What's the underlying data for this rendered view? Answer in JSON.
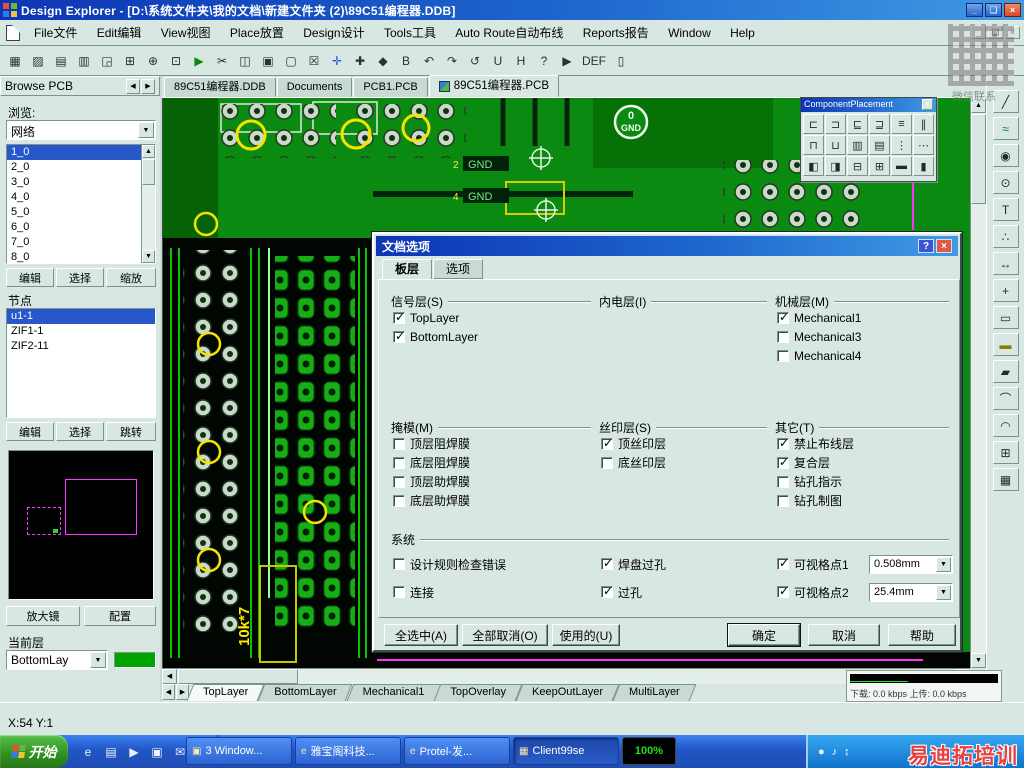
{
  "window": {
    "title": "Design Explorer - [D:\\系统文件夹\\我的文档\\新建文件夹 (2)\\89C51编程器.DDB]",
    "minimize_glyph": "_",
    "restore_glyph": "❏",
    "close_glyph": "×"
  },
  "ui": {
    "combo_arrow": "▼",
    "scroll_up": "▲",
    "scroll_down": "▼",
    "scroll_left": "◀",
    "scroll_right": "▶"
  },
  "menu": {
    "items": [
      {
        "label": "File文件"
      },
      {
        "label": "Edit编辑"
      },
      {
        "label": "View视图"
      },
      {
        "label": "Place放置"
      },
      {
        "label": "Design设计"
      },
      {
        "label": "Tools工具"
      },
      {
        "label": "Auto Route自动布线"
      },
      {
        "label": "Reports报告"
      },
      {
        "label": "Window"
      },
      {
        "label": "Help"
      }
    ]
  },
  "toolbar": {
    "buttons": [
      {
        "name": "explorer-toggle-icon",
        "glyph": "▦"
      },
      {
        "name": "open-document-icon",
        "glyph": "▨"
      },
      {
        "name": "save-icon",
        "glyph": "▤"
      },
      {
        "name": "print-icon",
        "glyph": "▥"
      },
      {
        "name": "print-preview-icon",
        "glyph": "◲"
      },
      {
        "name": "zoom-window-icon",
        "glyph": "⊞"
      },
      {
        "name": "zoom-point-icon",
        "glyph": "⊕"
      },
      {
        "name": "fit-document-icon",
        "glyph": "⊡"
      },
      {
        "name": "run-macro-icon",
        "glyph": "▶",
        "green": true
      },
      {
        "name": "cut-icon",
        "glyph": "✂"
      },
      {
        "name": "copy-icon",
        "glyph": "◫"
      },
      {
        "name": "paste-icon",
        "glyph": "▣"
      },
      {
        "name": "select-area-icon",
        "glyph": "▢"
      },
      {
        "name": "deselect-icon",
        "glyph": "☒"
      },
      {
        "name": "move-object-icon",
        "glyph": "✛",
        "blue": true
      },
      {
        "name": "crosshair-icon",
        "glyph": "✚"
      },
      {
        "name": "highlight-icon",
        "glyph": "◆"
      },
      {
        "name": "bold-text-icon",
        "glyph": "B"
      },
      {
        "name": "undo-icon",
        "glyph": "↶"
      },
      {
        "name": "redo-icon",
        "glyph": "↷"
      },
      {
        "name": "refresh-icon",
        "glyph": "↺"
      },
      {
        "name": "underline-tool-icon",
        "glyph": "U"
      },
      {
        "name": "h-tool-icon",
        "glyph": "H"
      },
      {
        "name": "help-icon",
        "glyph": "?"
      },
      {
        "name": "arrow-icon",
        "glyph": "▶"
      },
      {
        "name": "def-icon",
        "glyph": "DEF"
      },
      {
        "name": "clipboard-icon",
        "glyph": "▯"
      }
    ]
  },
  "doc_tabs": {
    "items": [
      {
        "label": "89C51编程器.DDB"
      },
      {
        "label": "Documents"
      },
      {
        "label": "PCB1.PCB"
      },
      {
        "label": "89C51编程器.PCB",
        "active": true
      }
    ]
  },
  "sidebar": {
    "tab_label": "Browse PCB",
    "browse_label": "浏览:",
    "browse_mode": "网络",
    "nets": [
      {
        "label": "1_0",
        "selected": true
      },
      {
        "label": "2_0"
      },
      {
        "label": "3_0"
      },
      {
        "label": "4_0"
      },
      {
        "label": "5_0"
      },
      {
        "label": "6_0"
      },
      {
        "label": "7_0"
      },
      {
        "label": "8_0"
      }
    ],
    "net_buttons": [
      {
        "label": "编辑"
      },
      {
        "label": "选择"
      },
      {
        "label": "缩放"
      }
    ],
    "nodes_label": "节点",
    "nodes": [
      {
        "label": "u1-1",
        "selected": true
      },
      {
        "label": "ZIF1-1"
      },
      {
        "label": "ZIF2-11"
      }
    ],
    "node_buttons": [
      {
        "label": "编辑"
      },
      {
        "label": "选择"
      },
      {
        "label": "跳转"
      }
    ],
    "magnifier_button": "放大镜",
    "config_button": "配置",
    "current_layer_label": "当前层",
    "current_layer": "BottomLay"
  },
  "editor": {
    "gnd_badge": {
      "line1": "0",
      "line2": "GND"
    },
    "net_label_1": "GND",
    "net_label_2": "GND",
    "ref_1": "2",
    "ref_2": "4",
    "resistor_label": "10k*7"
  },
  "component_placement": {
    "title": "ComponentPlacement",
    "close_glyph": "×",
    "tools": [
      {
        "name": "align-left-icon",
        "glyph": "⊏"
      },
      {
        "name": "align-right-icon",
        "glyph": "⊐"
      },
      {
        "name": "shift-left-icon",
        "glyph": "⊑"
      },
      {
        "name": "shift-right-icon",
        "glyph": "⊒"
      },
      {
        "name": "center-horizontal-icon",
        "glyph": "≡"
      },
      {
        "name": "space-horizontal-icon",
        "glyph": "∥"
      },
      {
        "name": "align-top-icon",
        "glyph": "⊓"
      },
      {
        "name": "align-bottom-icon",
        "glyph": "⊔"
      },
      {
        "name": "center-vertical-icon",
        "glyph": "▥"
      },
      {
        "name": "space-vertical-icon",
        "glyph": "▤"
      },
      {
        "name": "distribute-columns-icon",
        "glyph": "⋮"
      },
      {
        "name": "distribute-rows-icon",
        "glyph": "⋯"
      },
      {
        "name": "arrange-left-icon",
        "glyph": "◧"
      },
      {
        "name": "arrange-right-icon",
        "glyph": "◨"
      },
      {
        "name": "shrink-spacing-icon",
        "glyph": "⊟"
      },
      {
        "name": "expand-spacing-icon",
        "glyph": "⊞"
      },
      {
        "name": "room-icon",
        "glyph": "▬"
      },
      {
        "name": "component-icon",
        "glyph": "▮"
      }
    ]
  },
  "right_tools": [
    {
      "name": "place-track-icon",
      "glyph": "╱"
    },
    {
      "name": "place-multitrack-icon",
      "glyph": "≈"
    },
    {
      "name": "place-pad-icon",
      "glyph": "◉"
    },
    {
      "name": "place-via-icon",
      "glyph": "⊙"
    },
    {
      "name": "place-string-icon",
      "glyph": "T"
    },
    {
      "name": "place-coordinate-icon",
      "glyph": "∴"
    },
    {
      "name": "place-dimension-icon",
      "glyph": "↔"
    },
    {
      "name": "place-origin-icon",
      "glyph": "+"
    },
    {
      "name": "place-room-icon",
      "glyph": "▭"
    },
    {
      "name": "place-fill-icon",
      "glyph": "▬"
    },
    {
      "name": "place-polygon-icon",
      "glyph": "▰"
    },
    {
      "name": "place-arc-center-icon",
      "glyph": "⌒"
    },
    {
      "name": "place-arc-edge-icon",
      "glyph": "◠"
    },
    {
      "name": "place-array-icon",
      "glyph": "⊞"
    },
    {
      "name": "split-plane-icon",
      "glyph": "▦"
    }
  ],
  "dialog": {
    "title": "文档选项",
    "help_glyph": "?",
    "close_glyph": "×",
    "tabs": [
      {
        "label": "板层",
        "active": true
      },
      {
        "label": "选项",
        "active": false
      }
    ],
    "signal": {
      "label": "信号层(S)",
      "items": [
        {
          "label": "TopLayer",
          "checked": true
        },
        {
          "label": "BottomLayer",
          "checked": true
        }
      ]
    },
    "internal": {
      "label": "内电层(I)",
      "items": []
    },
    "mechanical": {
      "label": "机械层(M)",
      "items": [
        {
          "label": "Mechanical1",
          "checked": true
        },
        {
          "label": "Mechanical3"
        },
        {
          "label": "Mechanical4"
        }
      ]
    },
    "mask": {
      "label": "掩模(M)",
      "items": [
        {
          "label": "顶层阻焊膜"
        },
        {
          "label": "底层阻焊膜"
        },
        {
          "label": "顶层助焊膜"
        },
        {
          "label": "底层助焊膜"
        }
      ]
    },
    "silk": {
      "label": "丝印层(S)",
      "items": [
        {
          "label": "顶丝印层",
          "checked": true
        },
        {
          "label": "底丝印层"
        }
      ]
    },
    "other": {
      "label": "其它(T)",
      "items": [
        {
          "label": "禁止布线层",
          "checked": true
        },
        {
          "label": "复合层",
          "checked": true
        },
        {
          "label": "钻孔指示"
        },
        {
          "label": "钻孔制图"
        }
      ]
    },
    "system": {
      "label": "系统",
      "col1": [
        {
          "label": "设计规则检查错误"
        },
        {
          "label": "连接"
        }
      ],
      "col2": [
        {
          "label": "焊盘过孔",
          "checked": true
        },
        {
          "label": "过孔",
          "checked": true
        }
      ],
      "col3": [
        {
          "label": "可视格点1",
          "checked": true,
          "value": "0.508mm"
        },
        {
          "label": "可视格点2",
          "checked": true,
          "value": "25.4mm"
        }
      ]
    },
    "buttons": {
      "select_all": "全选中(A)",
      "deselect_all": "全部取消(O)",
      "used": "使用的(U)",
      "ok": "确定",
      "cancel": "取消",
      "help": "帮助"
    }
  },
  "layer_tabs": [
    {
      "label": "TopLayer",
      "active": true
    },
    {
      "label": "BottomLayer"
    },
    {
      "label": "Mechanical1"
    },
    {
      "label": "TopOverlay"
    },
    {
      "label": "KeepOutLayer"
    },
    {
      "label": "MultiLayer"
    }
  ],
  "status": {
    "coords": "X:54 Y:1"
  },
  "net_monitor": {
    "text": "下载: 0.0 kbps  上传: 0.0 kbps"
  },
  "taskbar": {
    "start_label": "开始",
    "quick_launch": [
      {
        "name": "ie-icon",
        "glyph": "e"
      },
      {
        "name": "show-desktop-icon",
        "glyph": "▤"
      },
      {
        "name": "media-player-icon",
        "glyph": "▶"
      },
      {
        "name": "folder-explorer-icon",
        "glyph": "▣"
      },
      {
        "name": "mail-icon",
        "glyph": "✉"
      },
      {
        "name": "messenger-icon",
        "glyph": "◎"
      }
    ],
    "tasks": [
      {
        "label": "3 Window...",
        "glyph": "▣"
      },
      {
        "label": "雅宝阁科技...",
        "glyph": "e"
      },
      {
        "label": "Protel-发...",
        "glyph": "e"
      },
      {
        "label": "Client99se",
        "glyph": "▦",
        "pressed": true
      },
      {
        "label": "100%",
        "meter": true
      }
    ],
    "tray_icons": [
      {
        "name": "antivirus-icon",
        "glyph": "●"
      },
      {
        "name": "volume-icon",
        "glyph": "♪"
      },
      {
        "name": "network-icon",
        "glyph": "↕"
      }
    ]
  },
  "watermarks": {
    "wechat": "微信联系",
    "brand": "易迪拓培训"
  }
}
